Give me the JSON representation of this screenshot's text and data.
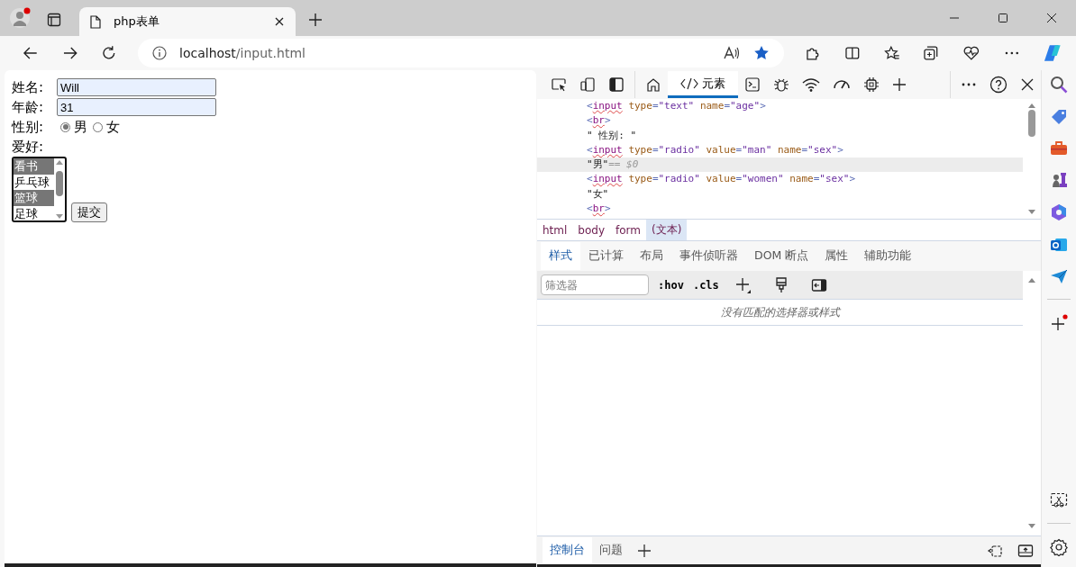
{
  "browser_tab": {
    "title": "php表单"
  },
  "address_bar": {
    "host": "localhost",
    "path": "/input.html"
  },
  "form": {
    "fields": [
      {
        "label": "姓名:",
        "value": "Will"
      },
      {
        "label": "年龄:",
        "value": "31"
      }
    ],
    "gender": {
      "label": "性别:",
      "options": [
        {
          "label": "男",
          "selected": true
        },
        {
          "label": "女",
          "selected": false
        }
      ]
    },
    "hobbies": {
      "label": "爱好:",
      "options": [
        {
          "label": "看书",
          "selected": true
        },
        {
          "label": "乒乓球",
          "selected": false
        },
        {
          "label": "篮球",
          "selected": true
        },
        {
          "label": "足球",
          "selected": false
        }
      ]
    },
    "submit": "提交"
  },
  "devtools": {
    "elements_tab": {
      "label": "元素",
      "selected": true
    },
    "dom_lines": [
      {
        "kind": "element",
        "text": "<input type=\"text\" name=\"age\">",
        "selected": false
      },
      {
        "kind": "element",
        "text": "<br>",
        "selected": false
      },
      {
        "kind": "text",
        "text": "\" 性别: \"",
        "selected": false
      },
      {
        "kind": "element",
        "text": "<input type=\"radio\" value=\"man\" name=\"sex\">",
        "selected": false
      },
      {
        "kind": "text",
        "text": "\"男\"",
        "selected": true,
        "suffix": "== $0"
      },
      {
        "kind": "element",
        "text": "<input type=\"radio\" value=\"women\" name=\"sex\">",
        "selected": false
      },
      {
        "kind": "text",
        "text": "\"女\"",
        "selected": false
      },
      {
        "kind": "element",
        "text": "<br>",
        "selected": false
      }
    ],
    "breadcrumbs": [
      {
        "label": "html",
        "selected": false
      },
      {
        "label": "body",
        "selected": false
      },
      {
        "label": "form",
        "selected": false
      },
      {
        "label": "(文本)",
        "selected": true
      }
    ],
    "style_tabs": [
      {
        "label": "样式",
        "selected": true
      },
      {
        "label": "已计算",
        "selected": false
      },
      {
        "label": "布局",
        "selected": false
      },
      {
        "label": "事件侦听器",
        "selected": false
      },
      {
        "label": "DOM 断点",
        "selected": false
      },
      {
        "label": "属性",
        "selected": false
      },
      {
        "label": "辅助功能",
        "selected": false
      }
    ],
    "filter": {
      "placeholder": "筛选器"
    },
    "style_buttons": [
      ":hov",
      ".cls"
    ],
    "empty_message": "没有匹配的选择器或样式",
    "drawer_tabs": [
      {
        "label": "控制台",
        "selected": true
      },
      {
        "label": "问题",
        "selected": false
      }
    ]
  }
}
